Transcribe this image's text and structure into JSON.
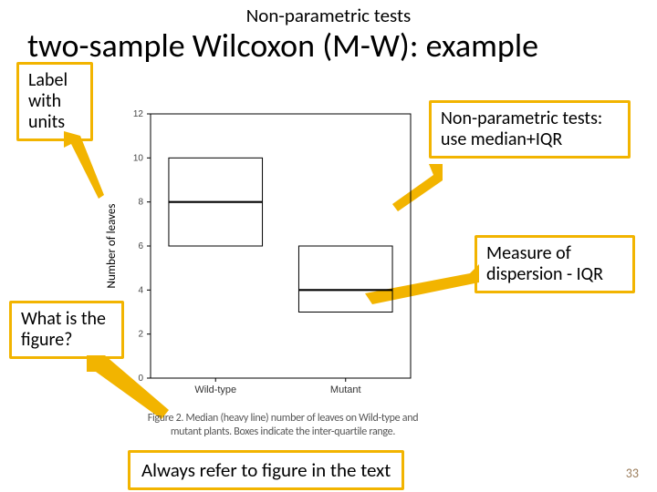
{
  "supertitle": "Non-parametric tests",
  "title": "two-sample Wilcoxon (M-W): example",
  "callouts": {
    "label_units": "Label with units",
    "nonparam": "Non-parametric tests: use median+IQR",
    "dispersion": "Measure of dispersion - IQR",
    "what_figure": "What is the figure?"
  },
  "bottom_box": "Always refer to figure in the text",
  "page_number": "33",
  "chart_data": {
    "type": "boxplot",
    "ylabel": "Number of leaves",
    "ylim": [
      0,
      12
    ],
    "yticks": [
      0,
      2,
      4,
      6,
      8,
      10,
      12
    ],
    "categories": [
      "Wild-type",
      "Mutant"
    ],
    "series": [
      {
        "name": "Wild-type",
        "q1": 6,
        "median": 8,
        "q3": 10
      },
      {
        "name": "Mutant",
        "q1": 3,
        "median": 4,
        "q3": 6
      }
    ],
    "caption": "Figure 2. Median (heavy line) number of leaves on Wild-type and mutant plants. Boxes indicate the inter-quartile range."
  }
}
